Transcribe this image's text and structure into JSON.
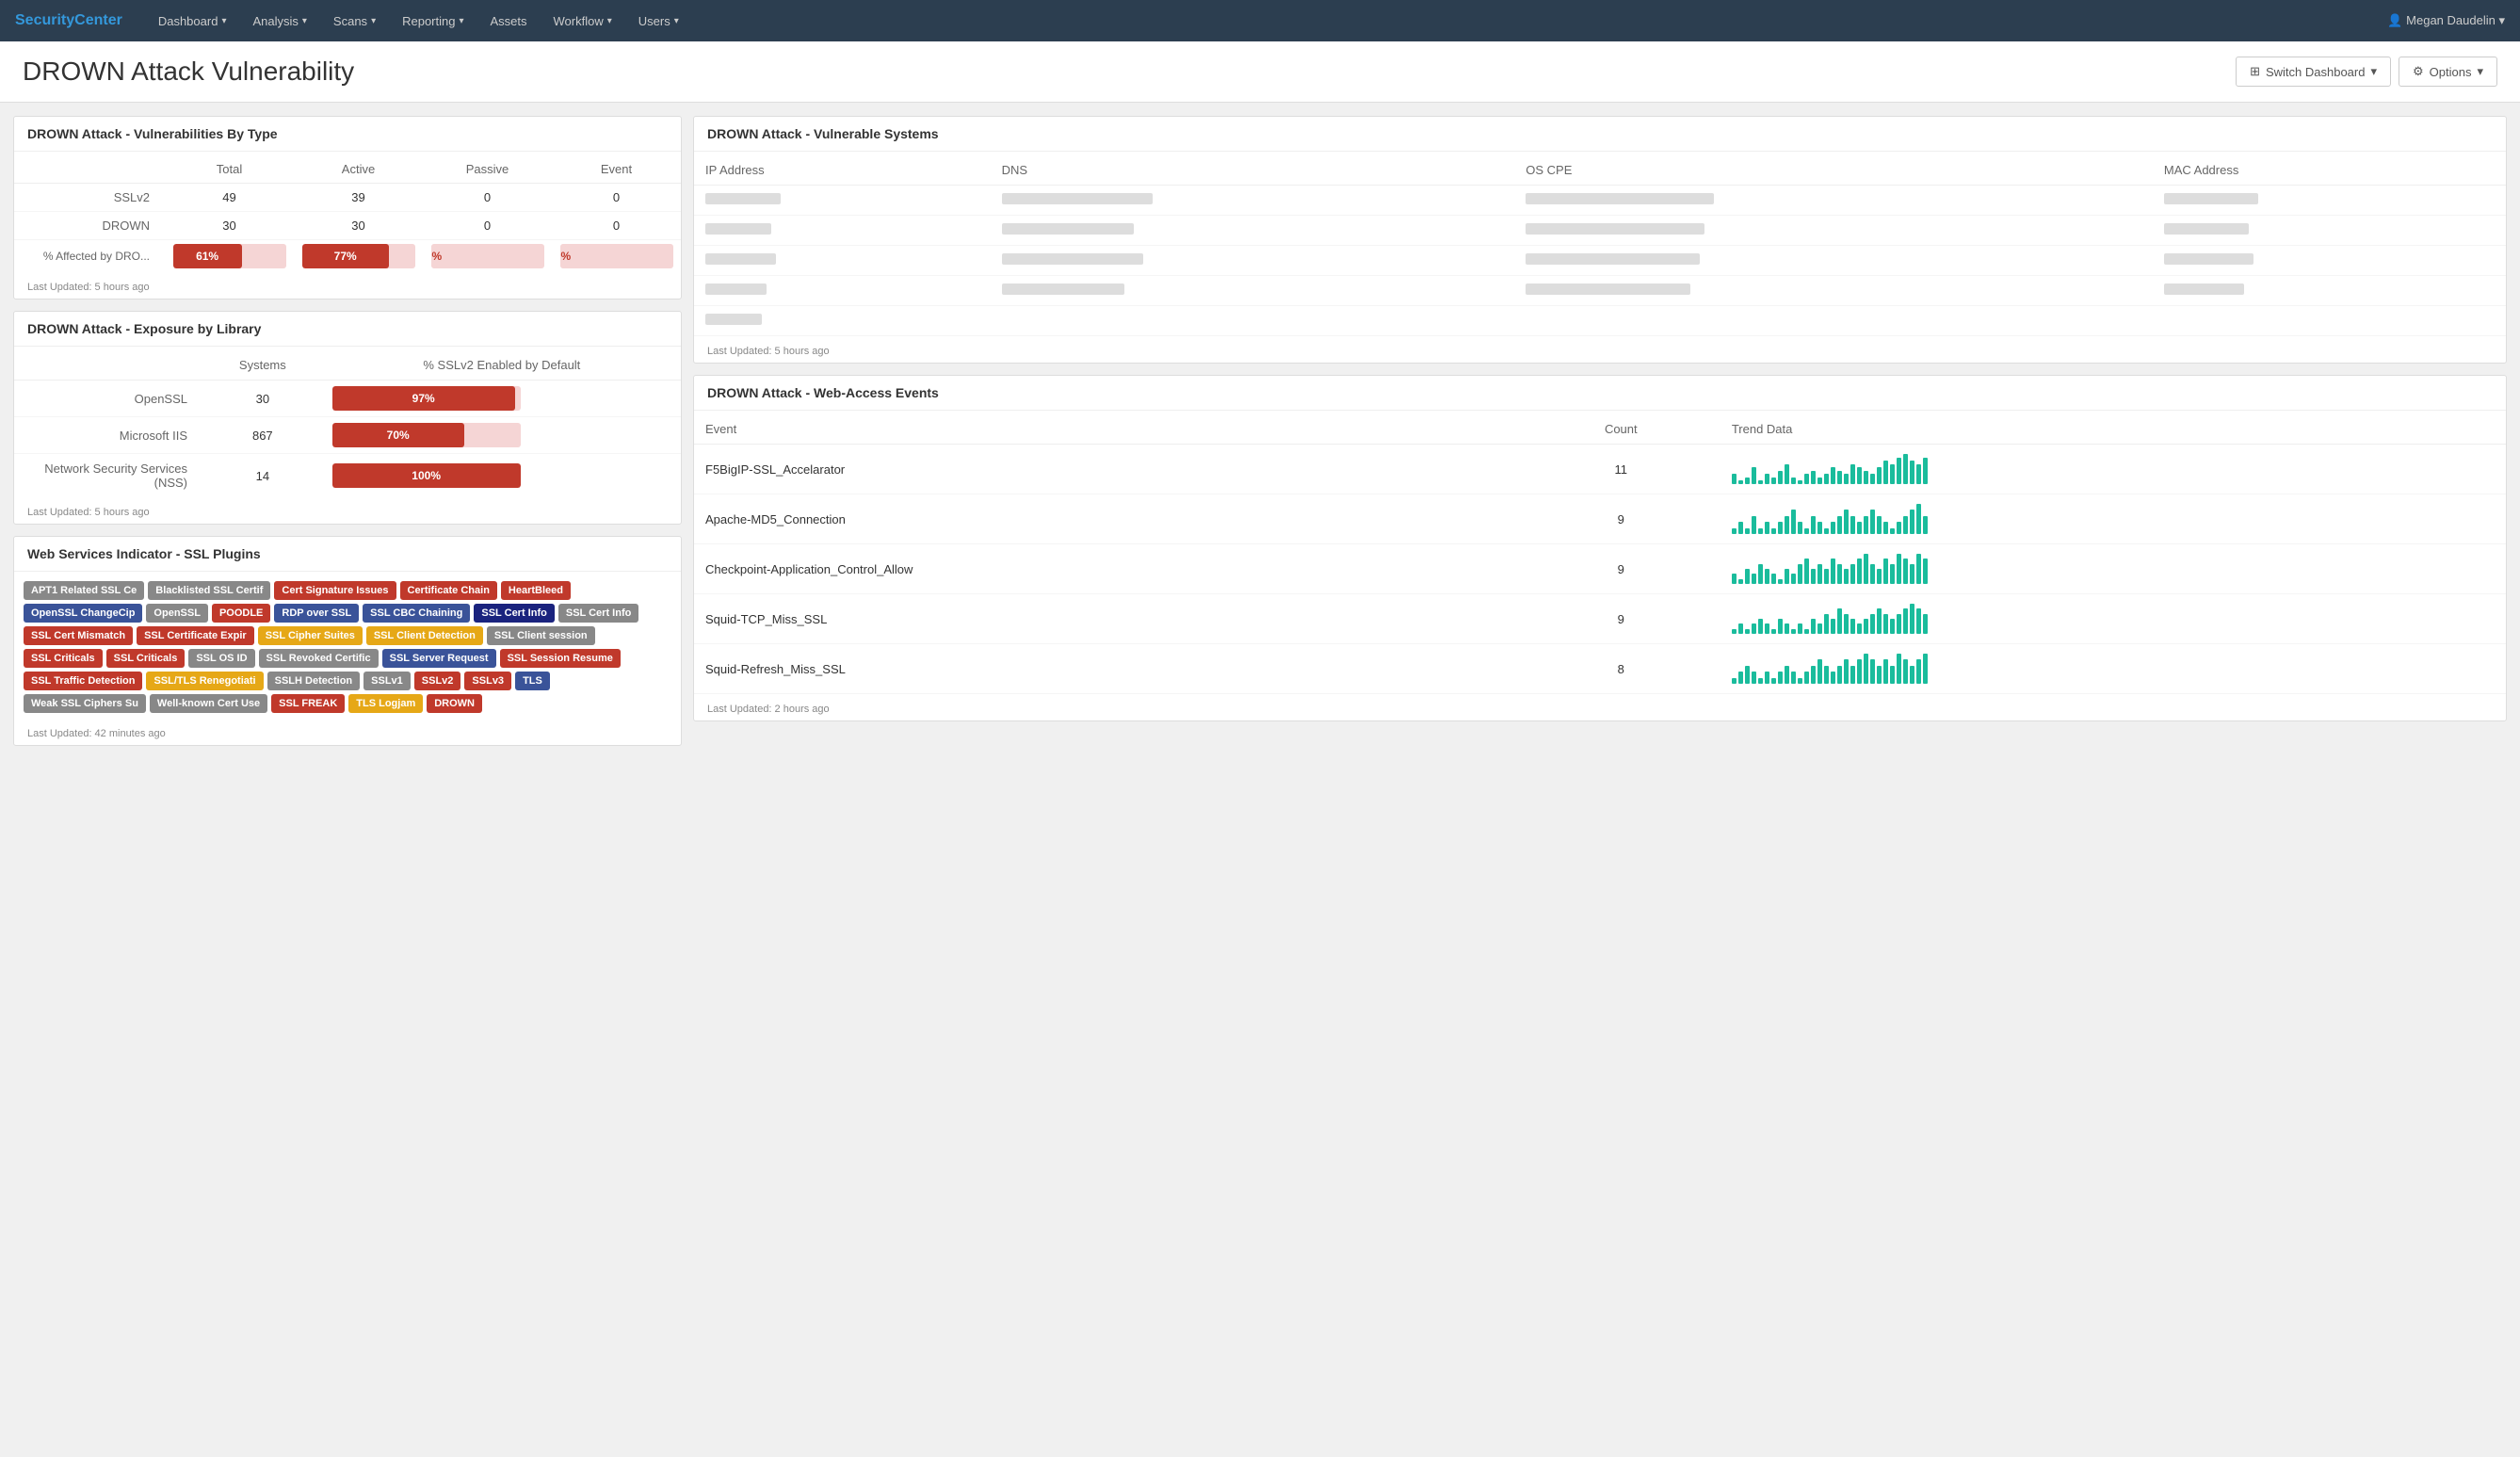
{
  "brand": {
    "name1": "Security",
    "name2": "Center"
  },
  "nav": {
    "items": [
      {
        "label": "Dashboard",
        "caret": true
      },
      {
        "label": "Analysis",
        "caret": true
      },
      {
        "label": "Scans",
        "caret": true
      },
      {
        "label": "Reporting",
        "caret": true
      },
      {
        "label": "Assets",
        "caret": false
      },
      {
        "label": "Workflow",
        "caret": true
      },
      {
        "label": "Users",
        "caret": true
      }
    ],
    "user": "Megan Daudelin"
  },
  "header": {
    "title": "DROWN Attack Vulnerability",
    "switch_dashboard": "Switch Dashboard",
    "options": "Options"
  },
  "vuln_by_type": {
    "title": "DROWN Attack - Vulnerabilities By Type",
    "columns": [
      "",
      "Total",
      "Active",
      "Passive",
      "Event"
    ],
    "rows": [
      {
        "label": "SSLv2",
        "total": "49",
        "active": "39",
        "passive": "0",
        "event": "0"
      },
      {
        "label": "DROWN",
        "total": "30",
        "active": "30",
        "passive": "0",
        "event": "0"
      },
      {
        "label": "% Affected by DRO...",
        "total": "61%",
        "active": "77%",
        "passive": "0%",
        "event": "0%"
      }
    ],
    "bars": {
      "total_pct": 61,
      "active_pct": 77,
      "passive_pct": 0,
      "event_pct": 0
    },
    "last_updated": "Last Updated: 5 hours ago"
  },
  "exposure": {
    "title": "DROWN Attack - Exposure by Library",
    "columns": [
      "",
      "Systems",
      "% SSLv2 Enabled by Default"
    ],
    "rows": [
      {
        "label": "OpenSSL",
        "systems": "30",
        "pct": 97,
        "pct_label": "97%"
      },
      {
        "label": "Microsoft IIS",
        "systems": "867",
        "pct": 70,
        "pct_label": "70%"
      },
      {
        "label": "Network Security Services (NSS)",
        "systems": "14",
        "pct": 100,
        "pct_label": "100%"
      }
    ],
    "last_updated": "Last Updated: 5 hours ago"
  },
  "ssl_plugins": {
    "title": "Web Services Indicator - SSL Plugins",
    "tags": [
      {
        "label": "APT1 Related SSL Ce",
        "style": "gray"
      },
      {
        "label": "Blacklisted SSL Certif",
        "style": "gray"
      },
      {
        "label": "Cert Signature Issues",
        "style": "red"
      },
      {
        "label": "Certificate Chain",
        "style": "red"
      },
      {
        "label": "HeartBleed",
        "style": "red"
      },
      {
        "label": "OpenSSL ChangeCip",
        "style": "blue"
      },
      {
        "label": "OpenSSL",
        "style": "gray"
      },
      {
        "label": "POODLE",
        "style": "red"
      },
      {
        "label": "RDP over SSL",
        "style": "blue"
      },
      {
        "label": "SSL CBC Chaining",
        "style": "blue"
      },
      {
        "label": "SSL Cert Info",
        "style": "dark-blue"
      },
      {
        "label": "SSL Cert Info",
        "style": "gray"
      },
      {
        "label": "SSL Cert Mismatch",
        "style": "red"
      },
      {
        "label": "SSL Certificate Expir",
        "style": "red"
      },
      {
        "label": "SSL Cipher Suites",
        "style": "yellow"
      },
      {
        "label": "SSL Client Detection",
        "style": "yellow"
      },
      {
        "label": "SSL Client session",
        "style": "gray"
      },
      {
        "label": "SSL Criticals",
        "style": "red"
      },
      {
        "label": "SSL Criticals",
        "style": "red"
      },
      {
        "label": "SSL OS ID",
        "style": "gray"
      },
      {
        "label": "SSL Revoked Certific",
        "style": "gray"
      },
      {
        "label": "SSL Server Request",
        "style": "blue"
      },
      {
        "label": "SSL Session Resume",
        "style": "red"
      },
      {
        "label": "SSL Traffic Detection",
        "style": "red"
      },
      {
        "label": "SSL/TLS Renegotiati",
        "style": "yellow"
      },
      {
        "label": "SSLH Detection",
        "style": "gray"
      },
      {
        "label": "SSLv1",
        "style": "gray"
      },
      {
        "label": "SSLv2",
        "style": "red"
      },
      {
        "label": "SSLv3",
        "style": "red"
      },
      {
        "label": "TLS",
        "style": "blue"
      },
      {
        "label": "Weak SSL Ciphers Su",
        "style": "gray"
      },
      {
        "label": "Well-known Cert Use",
        "style": "gray"
      },
      {
        "label": "SSL FREAK",
        "style": "red"
      },
      {
        "label": "TLS Logjam",
        "style": "yellow"
      },
      {
        "label": "DROWN",
        "style": "red"
      }
    ],
    "last_updated": "Last Updated: 42 minutes ago"
  },
  "vulnerable_systems": {
    "title": "DROWN Attack - Vulnerable Systems",
    "columns": [
      "IP Address",
      "DNS",
      "OS CPE",
      "MAC Address"
    ],
    "rows": [
      {
        "ip_w": 80,
        "dns_w": 160,
        "cpe_w": 200,
        "mac_w": 100
      },
      {
        "ip_w": 70,
        "dns_w": 140,
        "cpe_w": 190,
        "mac_w": 90
      },
      {
        "ip_w": 75,
        "dns_w": 150,
        "cpe_w": 185,
        "mac_w": 95
      },
      {
        "ip_w": 65,
        "dns_w": 130,
        "cpe_w": 175,
        "mac_w": 85
      },
      {
        "ip_w": 60,
        "dns_w": 120,
        "cpe_w": 0,
        "mac_w": 0
      }
    ],
    "last_updated": "Last Updated: 5 hours ago"
  },
  "web_access": {
    "title": "DROWN Attack - Web-Access Events",
    "columns": [
      "Event",
      "Count",
      "Trend Data"
    ],
    "rows": [
      {
        "event": "F5BigIP-SSL_Accelarator",
        "count": "11",
        "trend": [
          3,
          1,
          2,
          5,
          1,
          3,
          2,
          4,
          6,
          2,
          1,
          3,
          4,
          2,
          3,
          5,
          4,
          3,
          6,
          5,
          4,
          3,
          5,
          7,
          6,
          8,
          9,
          7,
          6,
          8
        ]
      },
      {
        "event": "Apache-MD5_Connection",
        "count": "9",
        "trend": [
          1,
          2,
          1,
          3,
          1,
          2,
          1,
          2,
          3,
          4,
          2,
          1,
          3,
          2,
          1,
          2,
          3,
          4,
          3,
          2,
          3,
          4,
          3,
          2,
          1,
          2,
          3,
          4,
          5,
          3
        ]
      },
      {
        "event": "Checkpoint-Application_Control_Allow",
        "count": "9",
        "trend": [
          2,
          1,
          3,
          2,
          4,
          3,
          2,
          1,
          3,
          2,
          4,
          5,
          3,
          4,
          3,
          5,
          4,
          3,
          4,
          5,
          6,
          4,
          3,
          5,
          4,
          6,
          5,
          4,
          6,
          5
        ]
      },
      {
        "event": "Squid-TCP_Miss_SSL",
        "count": "9",
        "trend": [
          1,
          2,
          1,
          2,
          3,
          2,
          1,
          3,
          2,
          1,
          2,
          1,
          3,
          2,
          4,
          3,
          5,
          4,
          3,
          2,
          3,
          4,
          5,
          4,
          3,
          4,
          5,
          6,
          5,
          4
        ]
      },
      {
        "event": "Squid-Refresh_Miss_SSL",
        "count": "8",
        "trend": [
          1,
          2,
          3,
          2,
          1,
          2,
          1,
          2,
          3,
          2,
          1,
          2,
          3,
          4,
          3,
          2,
          3,
          4,
          3,
          4,
          5,
          4,
          3,
          4,
          3,
          5,
          4,
          3,
          4,
          5
        ]
      }
    ],
    "last_updated": "Last Updated: 2 hours ago"
  }
}
